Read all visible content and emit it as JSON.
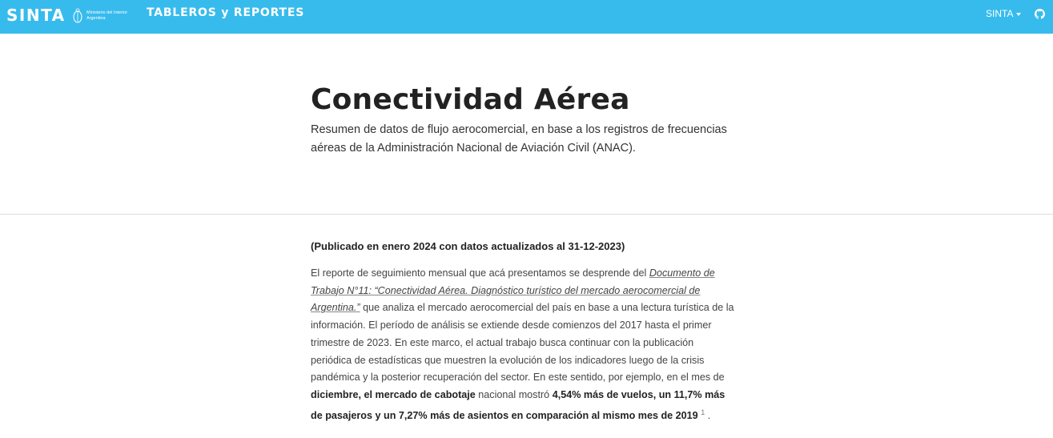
{
  "header": {
    "brand": "SINTA",
    "ministry_line1": "Ministerio del Interior",
    "ministry_line2": "Argentina",
    "nav_title": "TABLEROS y REPORTES",
    "menu_label": "SINTA",
    "colors": {
      "bar": "#37bbed",
      "text": "#ffffff"
    }
  },
  "hero": {
    "title": "Conectividad Aérea",
    "subtitle": "Resumen de datos de flujo aerocomercial, en base a los registros de frecuencias aéreas de la Administración Nacional de Aviación Civil (ANAC)."
  },
  "content": {
    "published": "(Publicado en enero 2024 con datos actualizados al 31-12-2023)",
    "p_intro": "El reporte de seguimiento mensual que acá presentamos se desprende del ",
    "p_link": "Documento de Trabajo N°11: “Conectividad Aérea. Diagnóstico turístico del mercado aerocomercial de Argentina.”",
    "p_body": " que analiza el mercado aerocomercial del país en base a una lectura turística de la información. El período de análisis se extiende desde comienzos del 2017 hasta el primer trimestre de 2023. En este marco, el actual trabajo busca continuar con la publicación periódica de estadísticas que muestren la evolución de los indicadores luego de la crisis pandémica y la posterior recuperación del sector. En este sentido, por ejemplo, en el mes de ",
    "p_bold1": "diciembre, el mercado de cabotaje",
    "p_mid": " nacional mostró ",
    "p_bold2": "4,54% más de vuelos, un 11,7% más de pasajeros y un 7,27% más de asientos en comparación al mismo mes de 2019",
    "p_footnote": "1",
    "p_end": "."
  }
}
